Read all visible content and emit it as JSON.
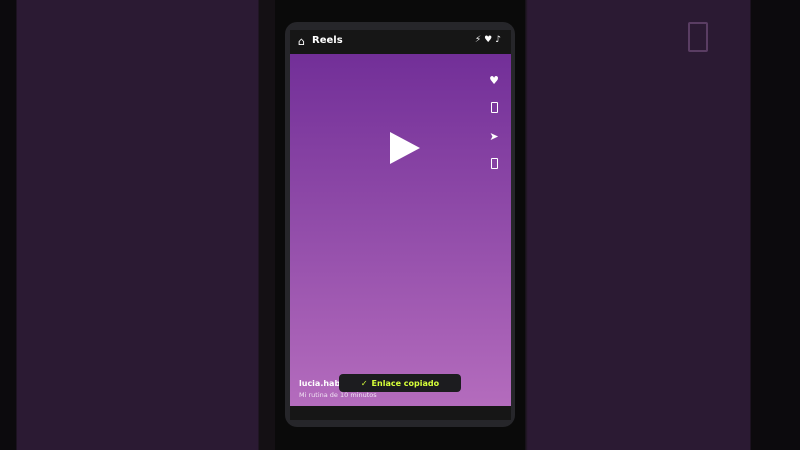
{
  "header": {
    "home_icon": "⌂",
    "title": "Reels",
    "status_icons": [
      "⚡",
      "♥",
      "♪"
    ]
  },
  "actions": {
    "like_icon": "♥",
    "share_icon": "➤"
  },
  "post": {
    "username": "lucia.hab",
    "caption": "Mi rutina de 10 minutos"
  },
  "toast": {
    "check": "✓",
    "text": "Enlace copiado"
  },
  "colors": {
    "toast_text": "#d6ff3a",
    "video_top": "#722f98",
    "video_bottom": "#b46cbd"
  }
}
